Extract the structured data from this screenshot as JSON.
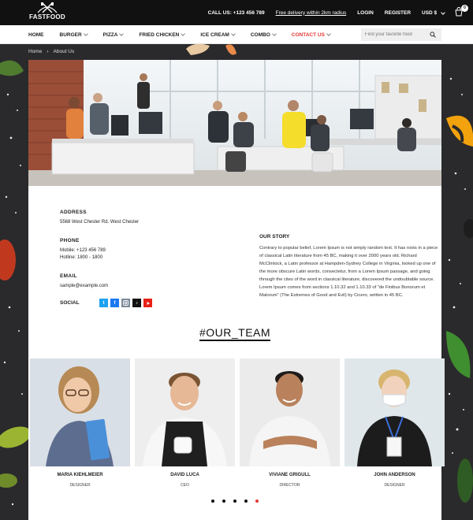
{
  "brand": {
    "logo_text": "FASTFOOD"
  },
  "topbar": {
    "call": "CALL US: +123 456 789",
    "delivery": "Free delivery within 2km radius",
    "login": "LOGIN",
    "register": "REGISTER",
    "currency": "USD $",
    "cart_count": "0"
  },
  "nav": {
    "items": [
      {
        "label": "HOME",
        "dropdown": false
      },
      {
        "label": "BURGER",
        "dropdown": true
      },
      {
        "label": "PIZZA",
        "dropdown": true
      },
      {
        "label": "FRIED CHICKEN",
        "dropdown": true
      },
      {
        "label": "ICE CREAM",
        "dropdown": true
      },
      {
        "label": "COMBO",
        "dropdown": true
      },
      {
        "label": "CONTACT US",
        "dropdown": true
      }
    ],
    "search_placeholder": "Find your favorite food"
  },
  "breadcrumb": {
    "home": "Home",
    "current": "About Us"
  },
  "contact": {
    "address_title": "ADDRESS",
    "address": "5568 West Chester Rd. West Chester",
    "phone_title": "PHONE",
    "mobile": "Mobile: +123 456 789",
    "hotline": "Hotline: 1800 - 1800",
    "email_title": "EMAIL",
    "email": "sample@example.com",
    "social_title": "SOCIAL"
  },
  "story": {
    "title": "OUR STORY",
    "text": "Contrary to popular belief, Lorem Ipsum is not simply random text. It has roots in a piece of classical Latin literature from 45 BC, making it over 2000 years old. Richard McClintock, a Latin professor at Hampden-Sydney College in Virginia, looked up one of the more obscure Latin words, consectetur, from a Lorem Ipsum passage, and going through the cites of the word in classical literature, discovered the undoubtable source. Lorem Ipsum comes from sections 1.10.32 and 1.10.33 of \"de Finibus Bonorum et Malorum\" (The Extremes of Good and Evil) by Cicero, written in 45 BC."
  },
  "team": {
    "heading": "#OUR_TEAM",
    "members": [
      {
        "name": "MARIA KIEHLMEIER",
        "role": "DESIGNER"
      },
      {
        "name": "DAVID LUCA",
        "role": "CEO"
      },
      {
        "name": "VIVIANE GRIGULL",
        "role": "DIRECTOR"
      },
      {
        "name": "JOHN ANDERSON",
        "role": "DESIGNER"
      }
    ]
  },
  "colors": {
    "accent": "#e53935",
    "dark": "#111111",
    "background": "#2a2a2c"
  }
}
